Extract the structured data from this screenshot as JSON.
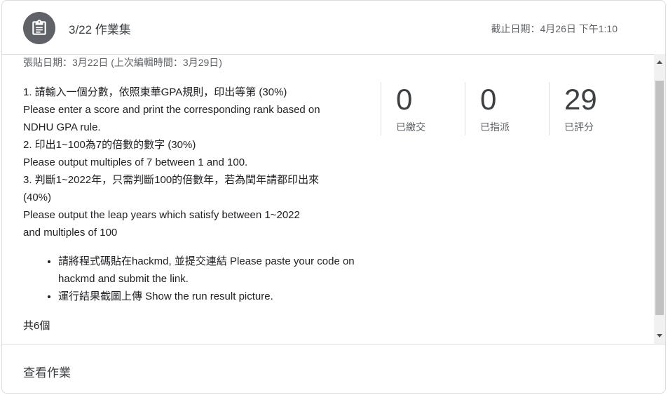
{
  "header": {
    "icon": "assignment-icon",
    "title": "3/22 作業集",
    "due_date": "截止日期：4月26日 下午1:10"
  },
  "assignment": {
    "posted": "張貼日期：3月22日 (上次編輯時間：3月29日)",
    "description_lines": [
      "1. 請輸入一個分數，依照東華GPA規則，印出等第 (30%)",
      "Please enter a score and print the corresponding rank based on",
      "NDHU GPA rule.",
      "2. 印出1~100為7的倍數的數字 (30%)",
      "Please output multiples of 7 between 1 and 100.",
      "3. 判斷1~2022年，只需判斷100的倍數年，若為閏年請都印出來",
      "(40%)",
      "Please output the leap years which satisfy between 1~2022",
      "and multiples of 100"
    ],
    "bullets": [
      "請將程式碼貼在hackmd, 並提交連結 Please paste your code on hackmd and submit the link.",
      "運行結果截圖上傳 Show the run result picture."
    ],
    "attachment_count": "共6個"
  },
  "stats": [
    {
      "value": "0",
      "label": "已繳交"
    },
    {
      "value": "0",
      "label": "已指派"
    },
    {
      "value": "29",
      "label": "已評分"
    }
  ],
  "footer": {
    "view_label": "查看作業"
  },
  "colors": {
    "icon_bg": "#5f6368",
    "divider": "#dadce0",
    "secondary_text": "#5f6368"
  }
}
